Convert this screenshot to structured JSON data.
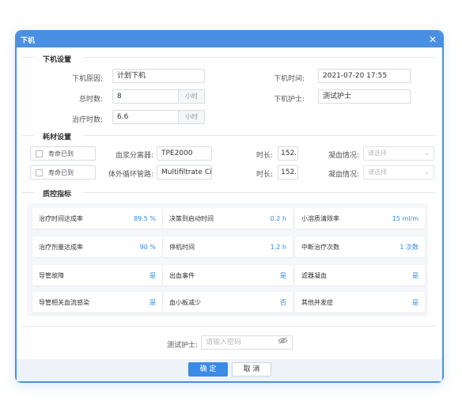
{
  "dialog": {
    "title": "下机"
  },
  "sections": {
    "offline": "下机设置",
    "consumables": "耗材设置",
    "quality": "质控指标"
  },
  "offline": {
    "reason_label": "下机原因:",
    "reason_value": "计划下机",
    "time_label": "下机时间:",
    "time_value": "2021-07-20 17:55",
    "total_label": "总时数:",
    "total_value": "8",
    "total_unit": "小时",
    "nurse_label": "下机护士:",
    "nurse_value": "测试护士",
    "treat_label": "治疗时数:",
    "treat_value": "6.6",
    "treat_unit": "小时"
  },
  "consumables": [
    {
      "check": "寿命已到",
      "name_label": "血浆分离器:",
      "name_value": "TPE2000",
      "dur_label": "时长:",
      "dur_value": "152.",
      "clot_label": "凝血情况:",
      "clot_placeholder": "请选择"
    },
    {
      "check": "寿命已到",
      "name_label": "体外循环管路:",
      "name_value": "Multifiltrate Ci-C",
      "dur_label": "时长:",
      "dur_value": "152.",
      "clot_label": "凝血情况:",
      "clot_placeholder": "请选择"
    }
  ],
  "quality": [
    {
      "label": "治疗时间达成率",
      "value": "89.5 %"
    },
    {
      "label": "决策到启动时间",
      "value": "0.2 h"
    },
    {
      "label": "小溶质清除率",
      "value": "15 ml/m"
    },
    {
      "label": "治疗剂量达成率",
      "value": "90 %"
    },
    {
      "label": "停机时间",
      "value": "1.2 h"
    },
    {
      "label": "中断治疗次数",
      "value": "1 次数"
    },
    {
      "label": "导管故障",
      "value": "是"
    },
    {
      "label": "出血事件",
      "value": "是"
    },
    {
      "label": "滤器凝血",
      "value": "是"
    },
    {
      "label": "导管相关血流感染",
      "value": "是"
    },
    {
      "label": "血小板减少",
      "value": "否"
    },
    {
      "label": "其他并发症",
      "value": "是"
    }
  ],
  "footer": {
    "nurse_label": "测试护士:",
    "password_placeholder": "请输入密码",
    "ok": "确 定",
    "cancel": "取 消"
  }
}
